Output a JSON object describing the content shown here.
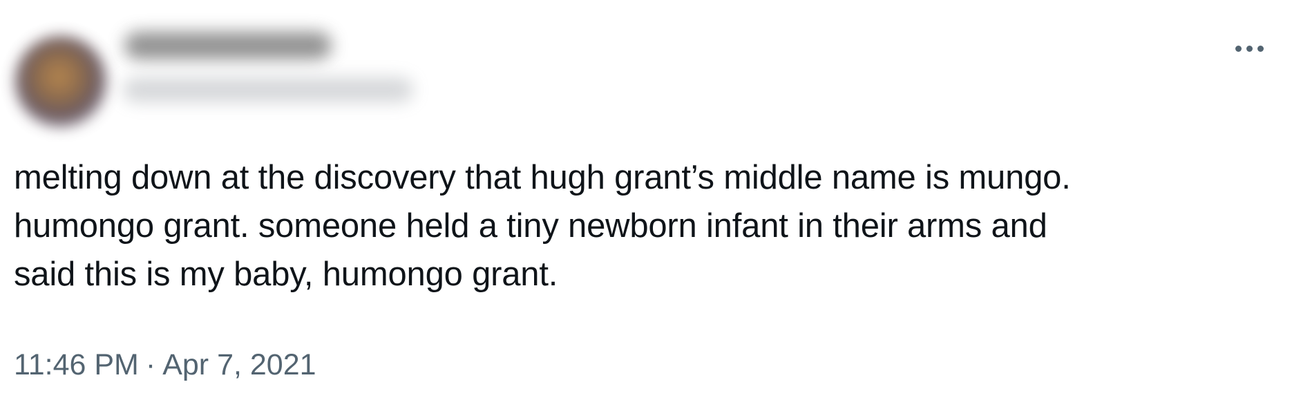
{
  "tweet": {
    "text_lines": [
      "melting down at the discovery that hugh grant’s middle name is mungo.",
      "humongo grant. someone held a tiny newborn infant in their arms and",
      "said this is my baby, humongo grant."
    ],
    "time": "11:46 PM",
    "separator": "·",
    "date": "Apr 7, 2021",
    "more_icon": "more-horizontal-icon"
  },
  "colors": {
    "text": "#0f1419",
    "secondary": "#536471",
    "background": "#ffffff"
  }
}
